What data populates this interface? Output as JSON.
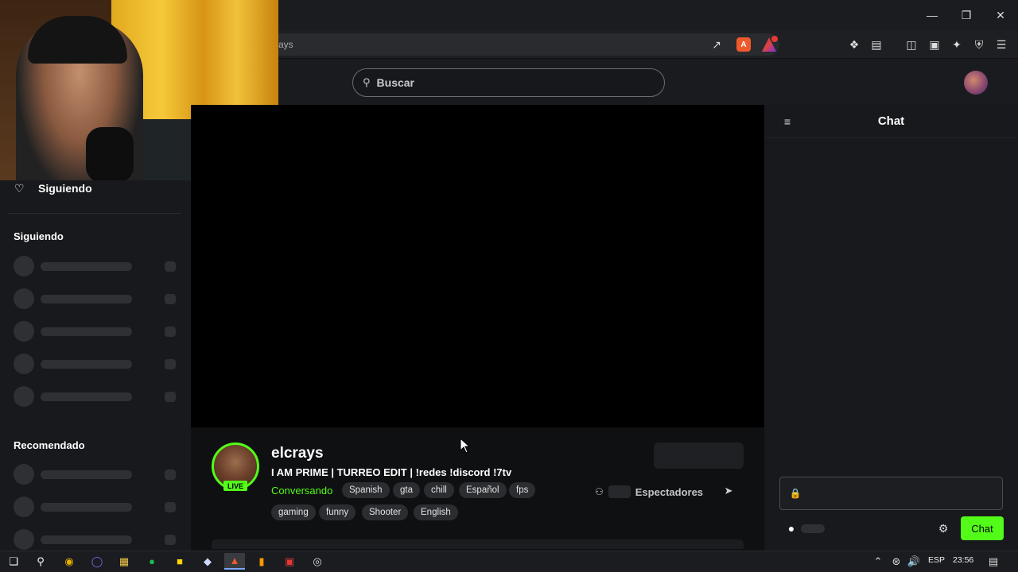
{
  "browser": {
    "url_fragment": "ays",
    "window_controls": {
      "minimize": "minimize-icon",
      "restore": "restore-icon",
      "close": "close-icon"
    },
    "brave_badge": "A",
    "rewards_count": "1"
  },
  "header": {
    "search_placeholder": "Buscar"
  },
  "sidebar": {
    "following_nav_label": "Siguiendo",
    "following_section_title": "Siguiendo",
    "recommended_section_title": "Recomendado"
  },
  "stream": {
    "live_badge": "LIVE",
    "channel_name": "elcrays",
    "title": "I AM PRIME | TURREO EDIT |  !redes !discord !7tv",
    "category": "Conversando",
    "tags_row1": [
      "Spanish",
      "gta",
      "chill",
      "Español",
      "fps"
    ],
    "tags_row2": [
      "gaming",
      "funny",
      "Shooter",
      "English"
    ],
    "viewers_label": "Espectadores"
  },
  "chat": {
    "title": "Chat",
    "send_label": "Chat"
  },
  "taskbar": {
    "language": "ESP",
    "time": "23:56"
  },
  "colors": {
    "accent": "#53fc18",
    "background": "#0f1012",
    "panel": "#18191c"
  }
}
